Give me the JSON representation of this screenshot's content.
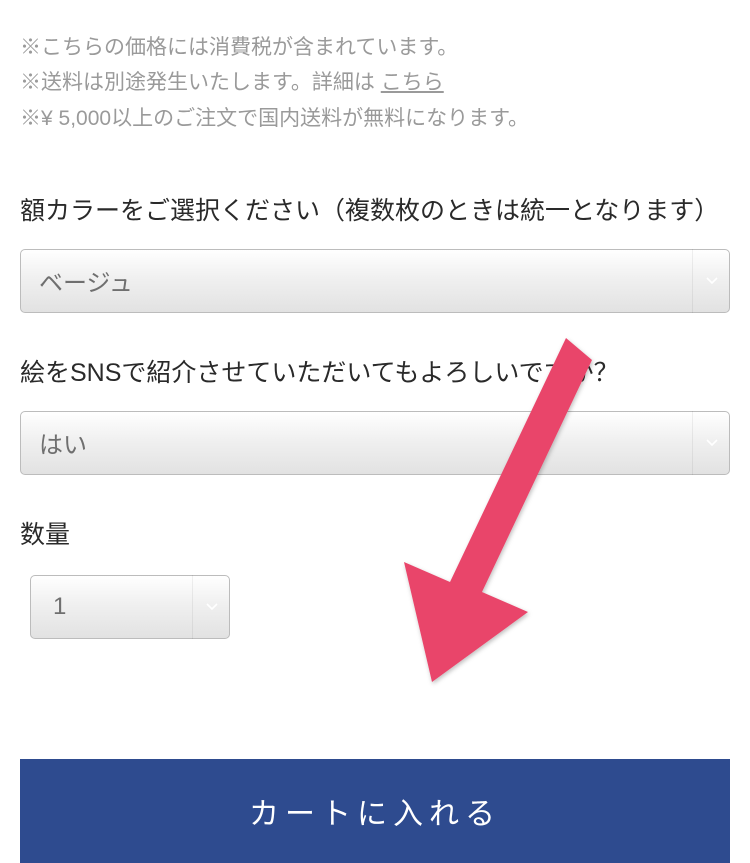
{
  "notices": {
    "line1": "※こちらの価格には消費税が含まれています。",
    "line2_prefix": "※送料は別途発生いたします。詳細は",
    "line2_link": "こちら",
    "line3": "※¥ 5,000以上のご注文で国内送料が無料になります。"
  },
  "form": {
    "frame_color": {
      "label": "額カラーをご選択ください（複数枚のときは統一となります）",
      "selected": "ベージュ"
    },
    "sns_permission": {
      "label": "絵をSNSで紹介させていただいてもよろしいですか？",
      "selected": "はい"
    },
    "quantity": {
      "label": "数量",
      "selected": "1"
    }
  },
  "cart_button_label": "カートに入れる",
  "colors": {
    "cart_button_bg": "#2e4b8f",
    "arrow_annotation": "#e9456a"
  }
}
